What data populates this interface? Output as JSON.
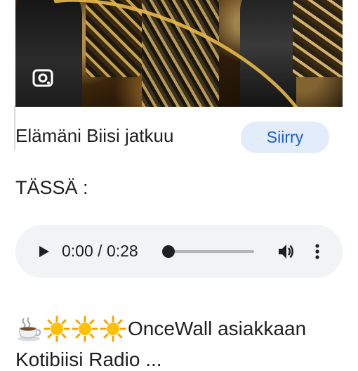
{
  "promo": {
    "title": "Elämäni Biisi jatkuu",
    "go_label": "Siirry",
    "image_icon": "google-lens-icon"
  },
  "section": {
    "label": "TÄSSÄ :"
  },
  "audio": {
    "current_time": "0:00",
    "separator": " / ",
    "duration": "0:28",
    "progress": 0.0,
    "icons": [
      "play-icon",
      "volume-icon",
      "more-vert-icon"
    ]
  },
  "post": {
    "emojis": [
      "hot-beverage-icon",
      "sun-icon",
      "sun-icon",
      "sun-icon"
    ],
    "text": "OnceWall asiakkaan",
    "next_line": "Kotibiisi Radio ..."
  },
  "colors": {
    "accent": "#1a5fd1",
    "button_bg": "#e3ecfb",
    "player_bg": "#f1f3f4",
    "gold": "#e7b84a"
  }
}
